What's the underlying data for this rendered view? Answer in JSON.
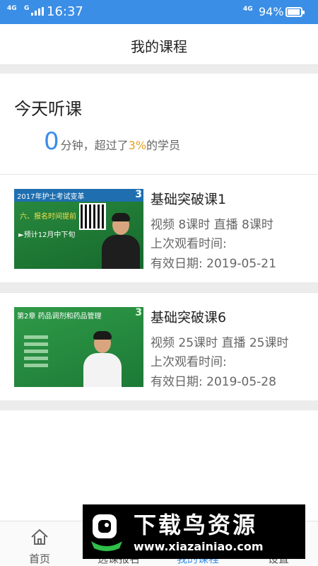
{
  "status_bar": {
    "network_left": "4G",
    "network_left_sub": "G",
    "time": "16:37",
    "network_right": "4G",
    "battery": "94%"
  },
  "header": {
    "title": "我的课程"
  },
  "today": {
    "heading": "今天听课",
    "minutes": "0",
    "minutes_unit": "分钟，超过了",
    "percent": "3%",
    "suffix": "的学员"
  },
  "courses": [
    {
      "name": "基础突破课1",
      "counts": "视频 8课时  直播 8课时",
      "last_watched": "上次观看时间:",
      "valid_until": "有效日期: 2019-05-21",
      "thumbnail": {
        "banner": "2017年护士考试变革",
        "board_lines": [
          "六、报名时间提前",
          "►预计12月中下旬"
        ]
      }
    },
    {
      "name": "基础突破课6",
      "counts": "视频 25课时  直播 25课时",
      "last_watched": "上次观看时间:",
      "valid_until": "有效日期: 2019-05-28",
      "thumbnail": {
        "banner": "第2章  药品调剂和药品管理"
      }
    }
  ],
  "bottom_nav": [
    {
      "label": "首页",
      "icon": "home-icon"
    },
    {
      "label": "选课报名",
      "icon": "course-select-icon"
    },
    {
      "label": "我的课程",
      "icon": "my-courses-icon"
    },
    {
      "label": "设置",
      "icon": "settings-icon"
    }
  ],
  "watermark": {
    "title": "下载鸟资源",
    "url": "www.xiazainiao.com"
  },
  "colors": {
    "accent": "#3a8ee6",
    "highlight": "#e6a020",
    "divider": "#ececec"
  }
}
